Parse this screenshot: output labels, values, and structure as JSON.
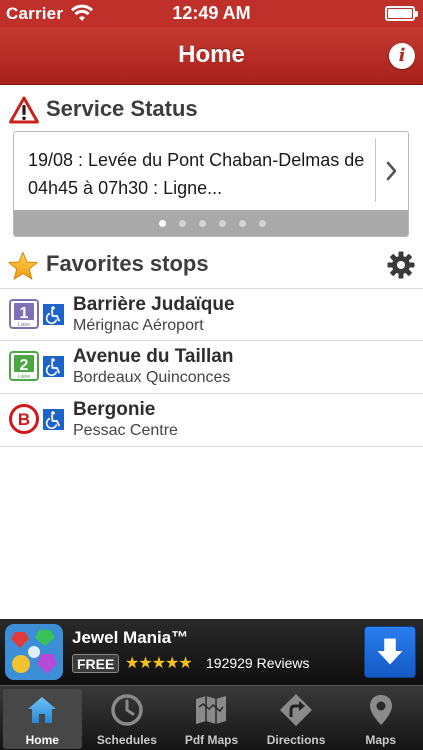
{
  "status_bar": {
    "carrier": "Carrier",
    "time": "12:49 AM"
  },
  "nav": {
    "title": "Home"
  },
  "service_status": {
    "title": "Service Status",
    "messages": [
      "19/08 : Levée du Pont Chaban-Delmas de 04h45 à 07h30 : Ligne..."
    ],
    "page_count": 6,
    "active_page": 1
  },
  "favorites": {
    "title": "Favorites stops",
    "items": [
      {
        "line": "1",
        "line_caption": "Liane",
        "line_color": "#7e70b5",
        "name": "Barrière Judaïque",
        "destination": "Mérignac Aéroport"
      },
      {
        "line": "2",
        "line_caption": "Liane",
        "line_color": "#4aa741",
        "name": "Avenue du Taillan",
        "destination": "Bordeaux Quinconces"
      },
      {
        "line": "B",
        "line_color": "#d4151b",
        "name": "Bergonie",
        "destination": "Pessac Centre"
      }
    ]
  },
  "ad": {
    "title": "Jewel Mania™",
    "badge": "FREE",
    "stars": "★★★★★",
    "reviews": "192929 Reviews"
  },
  "tabs": [
    {
      "label": "Home",
      "icon": "home-icon",
      "active": true
    },
    {
      "label": "Schedules",
      "icon": "clock-icon",
      "active": false
    },
    {
      "label": "Pdf Maps",
      "icon": "folded-map-icon",
      "active": false
    },
    {
      "label": "Directions",
      "icon": "directions-sign-icon",
      "active": false
    },
    {
      "label": "Maps",
      "icon": "map-pin-icon",
      "active": false
    }
  ],
  "colors": {
    "brand": "#b52a24",
    "active_tab": "#3aa3e8"
  }
}
